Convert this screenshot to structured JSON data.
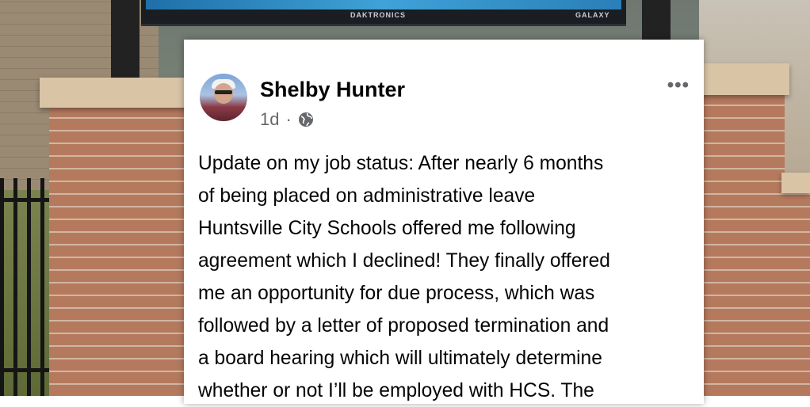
{
  "background": {
    "sign_brand_left": "DAKTRONICS",
    "sign_brand_right": "GALAXY"
  },
  "post": {
    "author": "Shelby Hunter",
    "timestamp": "1d",
    "separator": "·",
    "privacy_icon": "globe-icon",
    "more_icon": "ellipsis-icon",
    "more_glyph": "•••",
    "text_lines": [
      "Update on my job status: After nearly 6 months",
      "of being placed on administrative leave",
      "Huntsville City Schools offered me following",
      "agreement which I declined! They finally offered",
      "me an opportunity for due process, which was",
      "followed by a letter of proposed termination and",
      "a board hearing which will ultimately determine",
      "whether or not I’ll be employed with HCS. The"
    ]
  },
  "colors": {
    "card": "#ffffff",
    "text": "#050505",
    "muted": "#65676b"
  }
}
